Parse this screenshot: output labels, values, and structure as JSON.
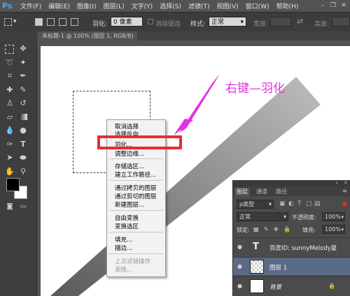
{
  "app": {
    "logo": "Ps"
  },
  "menubar": {
    "items": [
      "文件(F)",
      "编辑(E)",
      "图像(I)",
      "图层(L)",
      "文字(Y)",
      "选择(S)",
      "滤镜(T)",
      "视图(V)",
      "窗口(W)",
      "帮助(H)"
    ]
  },
  "options": {
    "feather_label": "羽化:",
    "feather_value": "0 像素",
    "antialias_label": "消除锯齿",
    "style_label": "样式:",
    "style_value": "正常",
    "width_label": "宽度:",
    "height_label": "高度:"
  },
  "document": {
    "tab_title": "未标题-1 @ 100% (图层 1, RGB/8)"
  },
  "annotation": "右键—羽化",
  "context_menu": {
    "items": [
      "取消选择",
      "选择反向",
      "羽化...",
      "调整边缘...",
      "存储选区...",
      "建立工作路径...",
      "通过拷贝的图层",
      "通过剪切的图层",
      "新建图层...",
      "自由变换",
      "变换选区",
      "填充...",
      "描边...",
      "上次滤镜操作",
      "渐隐..."
    ],
    "highlighted": "羽化..."
  },
  "layers_panel": {
    "tabs": [
      "图层",
      "通道",
      "路径"
    ],
    "filter_value": "ρ类型",
    "blend_mode": "正常",
    "opacity_label": "不透明度:",
    "opacity_value": "100%",
    "lock_label": "锁定:",
    "fill_label": "填充:",
    "fill_value": "100%",
    "layers": [
      {
        "name": "百度ID: sunnyMelody夏",
        "type": "text"
      },
      {
        "name": "图层 1",
        "type": "raster",
        "selected": true
      },
      {
        "name": "背景",
        "type": "background",
        "locked": true
      }
    ]
  },
  "colors": {
    "accent_red": "#e82d2d",
    "annotation_magenta": "#e232e2",
    "layer_selected": "#5a6b87"
  }
}
